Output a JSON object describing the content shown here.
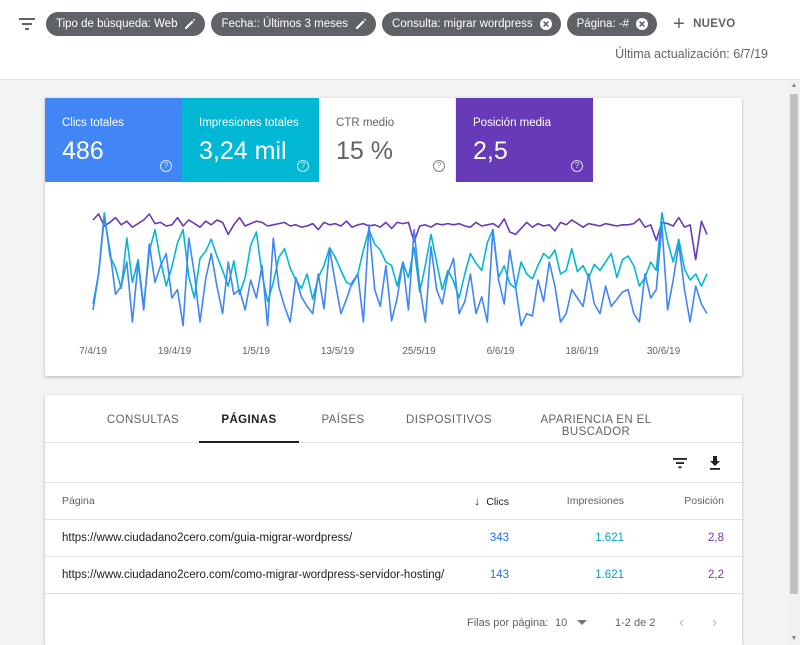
{
  "filters": [
    {
      "label": "Tipo de búsqueda: Web",
      "icon": "pencil-icon"
    },
    {
      "label": "Fecha:: Últimos 3 meses",
      "icon": "pencil-icon"
    },
    {
      "label": "Consulta: migrar wordpress",
      "icon": "close-icon"
    },
    {
      "label": "Página: -#",
      "icon": "close-icon"
    }
  ],
  "new_filter_label": "NUEVO",
  "last_update": "Última actualización: 6/7/19",
  "metrics": {
    "clicks": {
      "label": "Clics totales",
      "value": "486",
      "color": "#4285f4"
    },
    "impressions": {
      "label": "Impresiones totales",
      "value": "3,24 mil",
      "color": "#00b8d4"
    },
    "ctr": {
      "label": "CTR medio",
      "value": "15 %"
    },
    "position": {
      "label": "Posición media",
      "value": "2,5",
      "color": "#673ab7"
    }
  },
  "chart_data": {
    "type": "line",
    "x_tick_labels": [
      "7/4/19",
      "19/4/19",
      "1/5/19",
      "13/5/19",
      "25/5/19",
      "6/6/19",
      "18/6/19",
      "30/6/19"
    ],
    "grid": false,
    "legend": "none",
    "series": [
      {
        "metric": "position",
        "color": "#673ab7",
        "values": [
          0.9,
          0.95,
          0.85,
          0.88,
          0.92,
          0.86,
          0.89,
          0.84,
          0.87,
          0.9,
          0.95,
          0.87,
          0.88,
          0.85,
          0.86,
          0.92,
          0.85,
          0.9,
          0.87,
          0.84,
          0.89,
          0.86,
          0.9,
          0.88,
          0.78,
          0.86,
          0.92,
          0.85,
          0.87,
          0.89,
          0.88,
          0.85,
          0.86,
          0.87,
          0.88,
          0.85,
          0.86,
          0.84,
          0.85,
          0.87,
          0.82,
          0.88,
          0.86,
          0.87,
          0.85,
          0.89,
          0.84,
          0.86,
          0.87,
          0.85,
          0.86,
          0.84,
          0.88,
          0.83,
          0.88,
          0.87,
          0.88,
          0.72,
          0.85,
          0.86,
          0.84,
          0.87,
          0.86,
          0.87,
          0.86,
          0.87,
          0.85,
          0.84,
          0.88,
          0.85,
          0.86,
          0.87,
          0.84,
          0.91,
          0.8,
          0.78,
          0.83,
          0.88,
          0.84,
          0.87,
          0.85,
          0.86,
          0.81,
          0.88,
          0.86,
          0.9,
          0.87,
          0.84,
          0.87,
          0.86,
          0.85,
          0.87,
          0.86,
          0.85,
          0.86,
          0.86,
          0.87,
          0.91,
          0.84,
          0.86,
          0.73,
          0.88,
          0.87,
          0.85,
          0.92,
          0.84,
          0.86,
          0.57,
          0.89,
          0.78
        ]
      },
      {
        "metric": "impressions",
        "color": "#00b8d4",
        "values": [
          0.2,
          0.45,
          0.96,
          0.6,
          0.5,
          0.33,
          0.75,
          0.38,
          0.57,
          0.18,
          0.64,
          0.82,
          0.56,
          0.35,
          0.51,
          0.71,
          0.82,
          0.43,
          0.25,
          0.58,
          0.64,
          0.74,
          0.6,
          0.48,
          0.35,
          0.56,
          0.28,
          0.42,
          0.69,
          0.8,
          0.45,
          0.22,
          0.38,
          0.59,
          0.66,
          0.5,
          0.4,
          0.33,
          0.45,
          0.24,
          0.42,
          0.52,
          0.67,
          0.59,
          0.48,
          0.38,
          0.36,
          0.45,
          0.65,
          0.82,
          0.7,
          0.65,
          0.55,
          0.52,
          0.35,
          0.55,
          0.42,
          0.67,
          0.3,
          0.52,
          0.78,
          0.55,
          0.32,
          0.48,
          0.39,
          0.25,
          0.45,
          0.62,
          0.54,
          0.48,
          0.71,
          0.82,
          0.42,
          0.52,
          0.37,
          0.33,
          0.55,
          0.45,
          0.41,
          0.52,
          0.62,
          0.58,
          0.65,
          0.45,
          0.48,
          0.66,
          0.47,
          0.52,
          0.42,
          0.53,
          0.48,
          0.55,
          0.62,
          0.42,
          0.57,
          0.6,
          0.52,
          0.35,
          0.42,
          0.55,
          0.48,
          0.96,
          0.72,
          0.55,
          0.74,
          0.49,
          0.4,
          0.45,
          0.35,
          0.45
        ]
      },
      {
        "metric": "clicks",
        "color": "#4285f4",
        "values": [
          0.15,
          0.45,
          0.92,
          0.65,
          0.28,
          0.35,
          0.55,
          0.05,
          0.55,
          0.15,
          0.7,
          0.38,
          0.52,
          0.62,
          0.25,
          0.32,
          0.02,
          0.75,
          0.45,
          0.05,
          0.41,
          0.62,
          0.35,
          0.12,
          0.55,
          0.28,
          0.32,
          0.15,
          0.4,
          0.25,
          0.52,
          0.02,
          0.75,
          0.34,
          0.18,
          0.05,
          0.42,
          0.26,
          0.18,
          0.12,
          0.45,
          0.16,
          0.66,
          0.38,
          0.12,
          0.24,
          0.38,
          0.45,
          0.05,
          0.86,
          0.32,
          0.18,
          0.52,
          0.06,
          0.25,
          0.55,
          0.15,
          0.82,
          0.35,
          0.05,
          0.68,
          0.32,
          0.2,
          0.45,
          0.58,
          0.12,
          0.22,
          0.45,
          0.12,
          0.26,
          0.05,
          0.82,
          0.4,
          0.2,
          0.65,
          0.35,
          0.02,
          0.12,
          0.1,
          0.4,
          0.22,
          0.55,
          0.35,
          0.05,
          0.12,
          0.32,
          0.25,
          0.18,
          0.45,
          0.2,
          0.12,
          0.35,
          0.18,
          0.24,
          0.3,
          0.32,
          0.12,
          0.05,
          0.45,
          0.25,
          0.32,
          0.86,
          0.15,
          0.4,
          0.7,
          0.32,
          0.05,
          0.35,
          0.2,
          0.12
        ]
      }
    ]
  },
  "tabs": [
    "CONSULTAS",
    "PÁGINAS",
    "PAÍSES",
    "DISPOSITIVOS",
    "APARIENCIA EN EL BUSCADOR"
  ],
  "table": {
    "headers": {
      "page": "Página",
      "clicks": "Clics",
      "impressions": "Impresiones",
      "position": "Posición"
    },
    "rows": [
      {
        "page": "https://www.ciudadano2cero.com/guia-migrar-wordpress/",
        "clicks": "343",
        "impressions": "1.621",
        "position": "2,8"
      },
      {
        "page": "https://www.ciudadano2cero.com/como-migrar-wordpress-servidor-hosting/",
        "clicks": "143",
        "impressions": "1.621",
        "position": "2,2"
      }
    ]
  },
  "pagination": {
    "rows_per_page_label": "Filas por página:",
    "rows_per_page": "10",
    "range": "1-2 de 2"
  }
}
